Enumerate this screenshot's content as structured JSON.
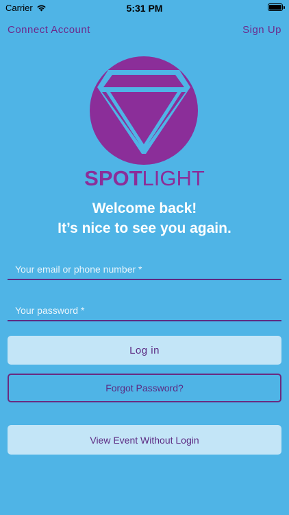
{
  "status_bar": {
    "carrier": "Carrier",
    "time": "5:31 PM"
  },
  "header": {
    "connect_account": "Connect Account",
    "sign_up": "Sign Up"
  },
  "brand": {
    "name_bold": "SPOT",
    "name_light": "LIGHT",
    "color": "#8b2e99"
  },
  "welcome": {
    "line1": "Welcome back!",
    "line2": "It’s nice to see you again."
  },
  "form": {
    "email_placeholder": "Your email or phone number *",
    "password_placeholder": "Your password *"
  },
  "buttons": {
    "login": "Log in",
    "forgot_password": "Forgot Password?",
    "view_event": "View Event Without Login"
  },
  "colors": {
    "background": "#4fb4e6",
    "accent": "#5c2a82",
    "button_fill": "#c3e5f7"
  }
}
